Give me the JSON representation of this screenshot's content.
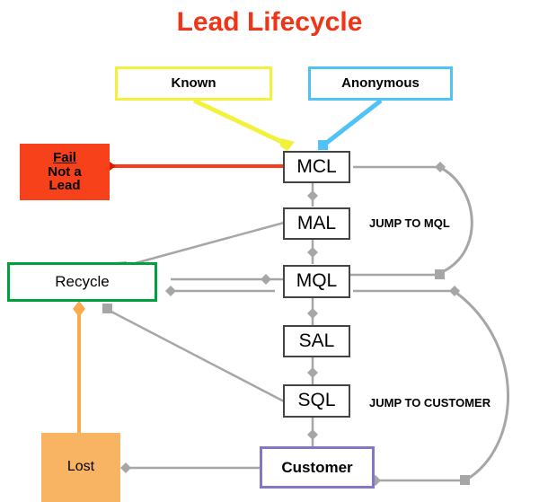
{
  "title": "Lead Lifecycle",
  "nodes": {
    "known": "Known",
    "anonymous": "Anonymous",
    "fail_line1": "Fail",
    "fail_line2": "Not a",
    "fail_line3": "Lead",
    "mcl": "MCL",
    "mal": "MAL",
    "mql": "MQL",
    "sal": "SAL",
    "sql": "SQL",
    "recycle": "Recycle",
    "lost": "Lost",
    "customer": "Customer"
  },
  "labels": {
    "jump_to_mql": "JUMP TO MQL",
    "jump_to_customer": "JUMP TO CUSTOMER"
  },
  "colors": {
    "title": "#f03417",
    "known_border": "#f2f23c",
    "anonymous_border": "#4fc3f7",
    "fail_fill": "#f7411b",
    "recycle_border": "#00a03c",
    "lost_fill": "#f9b463",
    "customer_border": "#8277c4",
    "stage_border": "#434343",
    "connector_gray": "#a6a6a6",
    "connector_red": "#fc3b1c",
    "connector_orange": "#f9a94e",
    "connector_yellow": "#f2f23c",
    "connector_blue": "#4fc3f7"
  },
  "connectors": [
    {
      "name": "known-to-mcl",
      "from": "known",
      "to": "mcl",
      "color": "#f2f23c"
    },
    {
      "name": "anonymous-to-mcl",
      "from": "anonymous",
      "to": "mcl",
      "color": "#4fc3f7"
    },
    {
      "name": "mcl-to-fail",
      "from": "mcl",
      "to": "fail",
      "color": "#fc3b1c"
    },
    {
      "name": "mcl-to-mal",
      "from": "mcl",
      "to": "mal",
      "color": "#a6a6a6"
    },
    {
      "name": "mal-to-recycle",
      "from": "mal",
      "to": "recycle",
      "color": "#a6a6a6"
    },
    {
      "name": "mal-to-mql",
      "from": "mal",
      "to": "mql",
      "color": "#a6a6a6"
    },
    {
      "name": "mql-to-recycle",
      "from": "mql",
      "to": "recycle",
      "color": "#a6a6a6"
    },
    {
      "name": "recycle-to-mql",
      "from": "recycle",
      "to": "mql",
      "color": "#a6a6a6"
    },
    {
      "name": "recycle-to-lost",
      "from": "recycle",
      "to": "lost",
      "color": "#f9a94e"
    },
    {
      "name": "mql-to-sal",
      "from": "mql",
      "to": "sal",
      "color": "#a6a6a6"
    },
    {
      "name": "sal-to-sql",
      "from": "sal",
      "to": "sql",
      "color": "#a6a6a6"
    },
    {
      "name": "sql-to-recycle",
      "from": "sql",
      "to": "recycle",
      "color": "#a6a6a6"
    },
    {
      "name": "sql-to-customer",
      "from": "sql",
      "to": "customer",
      "color": "#a6a6a6"
    },
    {
      "name": "customer-to-lost",
      "from": "customer",
      "to": "lost",
      "color": "#a6a6a6"
    },
    {
      "name": "jump-to-mql-curve",
      "from": "mcl",
      "to": "mql",
      "color": "#a6a6a6"
    },
    {
      "name": "jump-to-customer-curve",
      "from": "mql",
      "to": "customer",
      "color": "#a6a6a6"
    }
  ]
}
